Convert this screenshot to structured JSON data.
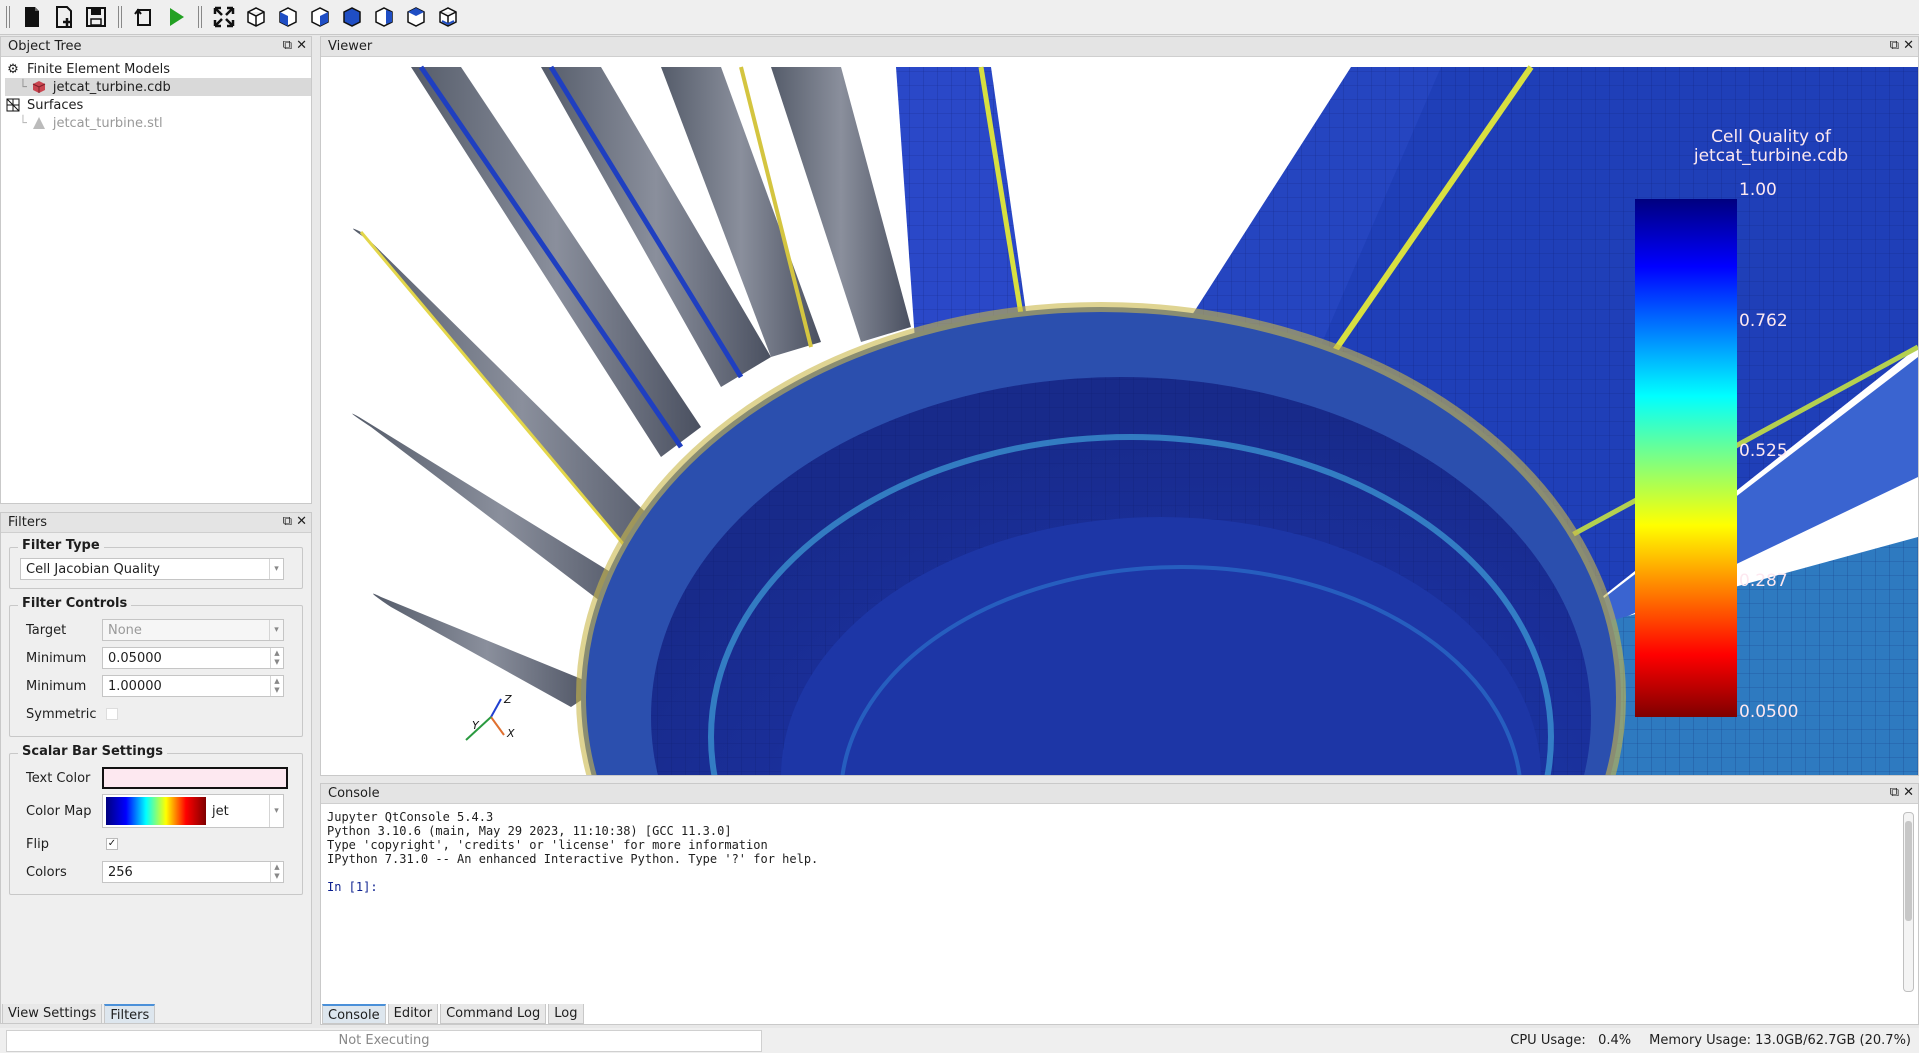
{
  "toolbar": {
    "buttons": [
      "new-file-icon",
      "new-document-icon",
      "save-icon",
      "reload-icon",
      "run-icon",
      "fit-view-icon",
      "view-iso-icon",
      "view-front-icon",
      "view-back-icon",
      "view-left-icon",
      "view-right-icon",
      "view-top-icon",
      "view-bottom-icon"
    ],
    "run_color": "#22a022"
  },
  "object_tree": {
    "title": "Object Tree",
    "items": [
      {
        "label": "Finite Element Models",
        "level": 0,
        "icon": "gear-icon"
      },
      {
        "label": "jetcat_turbine.cdb",
        "level": 1,
        "icon": "mesh-cube-icon",
        "selected": true
      },
      {
        "label": "Surfaces",
        "level": 0,
        "icon": "surface-grid-icon"
      },
      {
        "label": "jetcat_turbine.stl",
        "level": 1,
        "icon": "triangle-icon",
        "disabled": true
      }
    ]
  },
  "filters": {
    "title": "Filters",
    "filter_type": {
      "title": "Filter Type",
      "value": "Cell Jacobian Quality"
    },
    "filter_controls": {
      "title": "Filter Controls",
      "target_label": "Target",
      "target_value": "None",
      "min_label": "Minimum",
      "min_value": "0.05000",
      "max_label": "Minimum",
      "max_value": "1.00000",
      "symmetric_label": "Symmetric",
      "symmetric_checked": false
    },
    "scalar_bar": {
      "title": "Scalar Bar Settings",
      "text_color_label": "Text Color",
      "text_color": "#fde8f0",
      "colormap_label": "Color Map",
      "colormap_value": "jet",
      "flip_label": "Flip",
      "flip_checked": true,
      "colors_label": "Colors",
      "colors_value": "256"
    }
  },
  "left_tabs": [
    "View Settings",
    "Filters"
  ],
  "left_active_tab": "Filters",
  "viewer": {
    "title": "Viewer",
    "scalar_bar_title_1": "Cell Quality of",
    "scalar_bar_title_2": "jetcat_turbine.cdb",
    "scalar_labels": [
      "1.00",
      "0.762",
      "0.525",
      "0.287",
      "0.0500"
    ],
    "axes": {
      "x": "X",
      "y": "Y",
      "z": "Z"
    }
  },
  "console": {
    "title": "Console",
    "lines": [
      "Jupyter QtConsole 5.4.3",
      "Python 3.10.6 (main, May 29 2023, 11:10:38) [GCC 11.3.0]",
      "Type 'copyright', 'credits' or 'license' for more information",
      "IPython 7.31.0 -- An enhanced Interactive Python. Type '?' for help."
    ],
    "prompt": "In [1]:"
  },
  "bottom_tabs": [
    "Console",
    "Editor",
    "Command Log",
    "Log"
  ],
  "bottom_active_tab": "Console",
  "status": {
    "execution": "Not Executing",
    "cpu": "CPU Usage:   0.4%",
    "memory": "Memory Usage: 13.0GB/62.7GB (20.7%)"
  }
}
